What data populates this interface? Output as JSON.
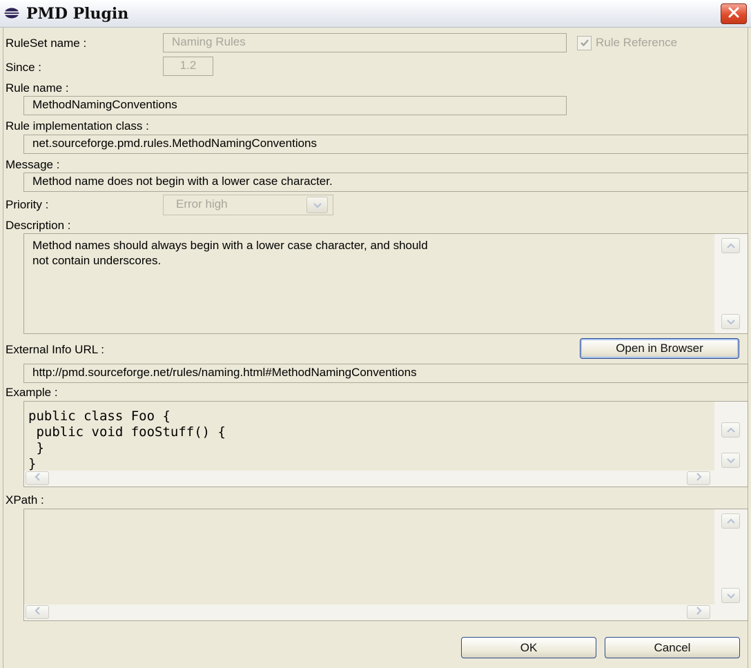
{
  "window": {
    "title": "PMD Plugin",
    "close_icon": "close-icon",
    "title_icon": "eclipse-icon"
  },
  "ruleset": {
    "label": "RuleSet name :",
    "value": "Naming Rules",
    "rule_reference_label": "Rule Reference",
    "rule_reference_checked": true
  },
  "since": {
    "label": "Since :",
    "value": "1.2"
  },
  "rule_name": {
    "label": "Rule name :",
    "value": "MethodNamingConventions"
  },
  "impl_class": {
    "label": "Rule implementation class :",
    "value": "net.sourceforge.pmd.rules.MethodNamingConventions"
  },
  "message": {
    "label": "Message :",
    "value": "Method name does not begin with a lower case character."
  },
  "priority": {
    "label": "Priority :",
    "value": "Error high"
  },
  "description": {
    "label": "Description :",
    "value": "Method names should always begin with a lower case character, and should\nnot contain underscores."
  },
  "external_info": {
    "label": "External Info URL :",
    "open_button": "Open in Browser",
    "url": "http://pmd.sourceforge.net/rules/naming.html#MethodNamingConventions"
  },
  "example": {
    "label": "Example :",
    "code": "public class Foo {\n public void fooStuff() {\n }\n}"
  },
  "xpath": {
    "label": "XPath :",
    "value": ""
  },
  "buttons": {
    "ok": "OK",
    "cancel": "Cancel"
  },
  "colors": {
    "dialog_bg": "#ece9d8",
    "close_red": "#df4b2c",
    "button_border": "#2f4b8c",
    "disabled_text": "#a7a69b"
  }
}
